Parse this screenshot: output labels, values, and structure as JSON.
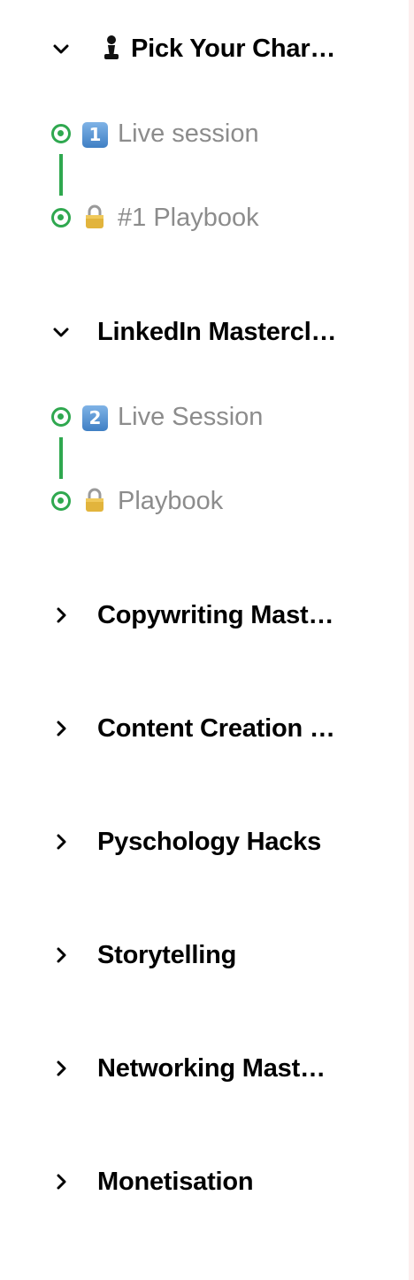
{
  "sections": [
    {
      "title": "♟ Pick Your Char...",
      "title_text": "Pick Your Char…",
      "icon": "chess-pawn-icon",
      "expanded": true,
      "lessons": [
        {
          "badge": "1",
          "icon": "keycap-one-icon",
          "label": "Live session",
          "status": "completed"
        },
        {
          "icon": "lock-icon",
          "label": "#1 Playbook",
          "status": "completed"
        }
      ]
    },
    {
      "title_text": "LinkedIn Mastercl…",
      "expanded": true,
      "lessons": [
        {
          "badge": "2",
          "icon": "keycap-two-icon",
          "label": "Live Session",
          "status": "completed"
        },
        {
          "icon": "lock-icon",
          "label": "Playbook",
          "status": "completed"
        }
      ]
    },
    {
      "title_text": "Copywriting Mast…",
      "expanded": false
    },
    {
      "title_text": "Content Creation …",
      "expanded": false
    },
    {
      "title_text": "Pyschology Hacks",
      "expanded": false
    },
    {
      "title_text": "Storytelling",
      "expanded": false
    },
    {
      "title_text": "Networking Mast…",
      "expanded": false
    },
    {
      "title_text": "Monetisation",
      "expanded": false
    }
  ],
  "colors": {
    "complete": "#2fa84f",
    "lesson_text": "#8c8c8c",
    "title_text": "#000000"
  }
}
